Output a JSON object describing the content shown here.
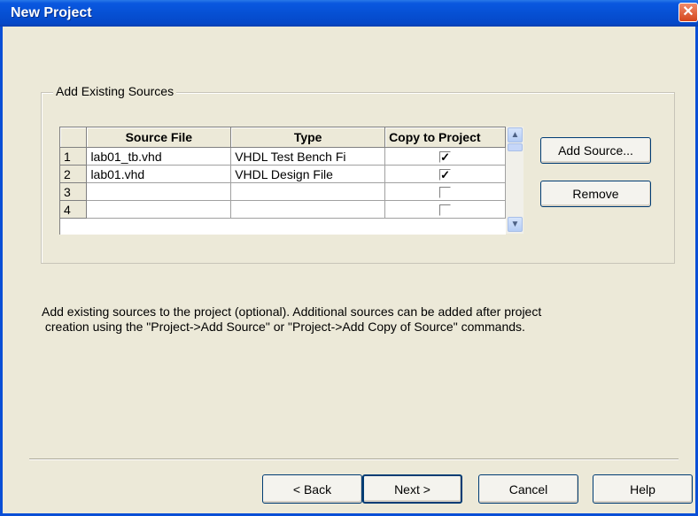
{
  "window": {
    "title": "New Project",
    "close_glyph": "✕"
  },
  "group": {
    "label": "Add Existing Sources"
  },
  "table": {
    "columns": [
      "",
      "Source File",
      "Type",
      "Copy to Project"
    ],
    "rows": [
      {
        "num": "1",
        "file": "lab01_tb.vhd",
        "type": "VHDL Test Bench Fi",
        "copy": "✓"
      },
      {
        "num": "2",
        "file": "lab01.vhd",
        "type": "VHDL Design File",
        "copy": "✓"
      },
      {
        "num": "3",
        "file": "",
        "type": "",
        "copy": ""
      },
      {
        "num": "4",
        "file": "",
        "type": "",
        "copy": ""
      }
    ]
  },
  "scrollbar": {
    "up_icon": "chevron-up-icon",
    "down_icon": "chevron-down-icon",
    "up_glyph": "▲",
    "down_glyph": "▼"
  },
  "side_buttons": {
    "add_source": "Add Source...",
    "remove": "Remove"
  },
  "description": {
    "line1": "Add existing sources to the project (optional). Additional sources can be added after project",
    "line2": " creation using the \"Project->Add Source\" or \"Project->Add Copy of Source\" commands."
  },
  "footer": {
    "back": "< Back",
    "next": "Next >",
    "cancel": "Cancel",
    "help": "Help"
  },
  "colors": {
    "titlebar": "#0650d4",
    "dialog_bg": "#ece9d8",
    "button_border": "#003c74"
  }
}
